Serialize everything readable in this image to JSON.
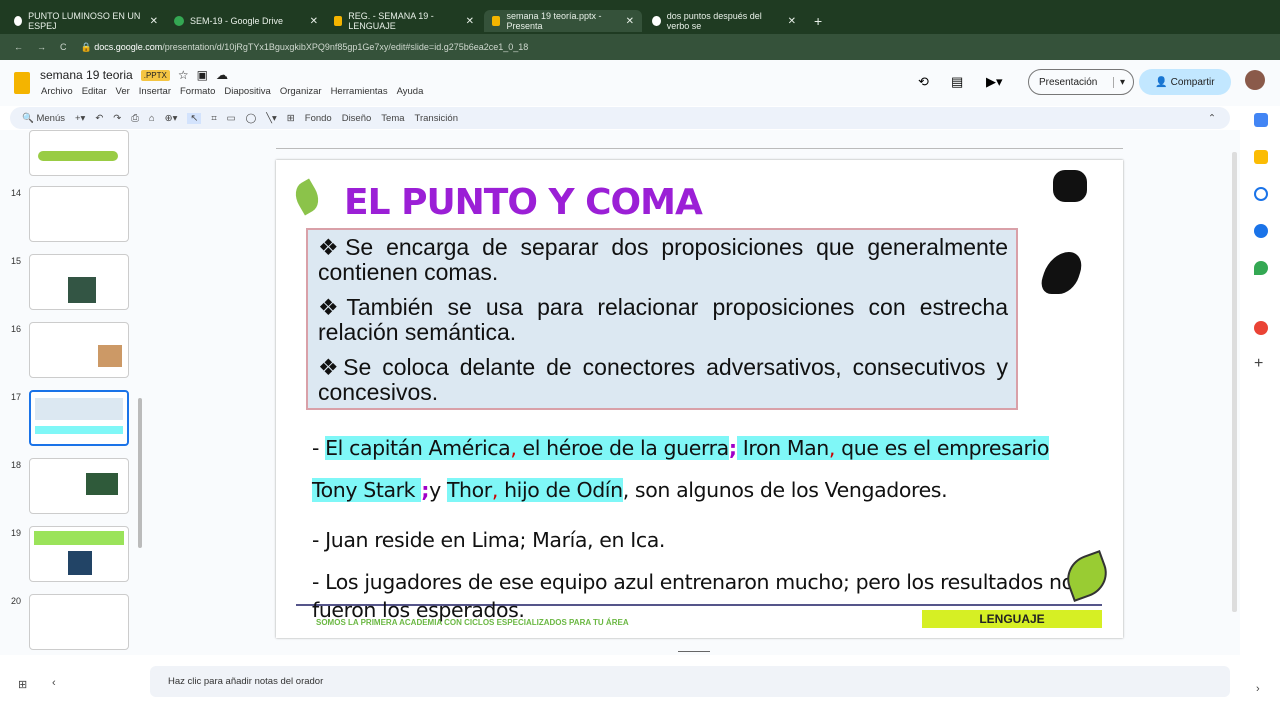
{
  "browser": {
    "tabs": [
      {
        "title": "PUNTO LUMINOSO EN UN ESPEJ",
        "active": false
      },
      {
        "title": "SEM-19 - Google Drive",
        "active": false
      },
      {
        "title": "REG. - SEMANA 19 - LENGUAJE",
        "active": false
      },
      {
        "title": "semana 19 teoría.pptx - Presenta",
        "active": true
      },
      {
        "title": "dos puntos después del verbo se",
        "active": false
      }
    ],
    "url_domain": "docs.google.com",
    "url_path": "/presentation/d/10jRgTYx1BguxgkibXPQ9nf85gp1Ge7xy/edit#slide=id.g275b6ea2ce1_0_18"
  },
  "app": {
    "doc_title": "semana 19 teoria",
    "badge": ".PPTX",
    "menu": [
      "Archivo",
      "Editar",
      "Ver",
      "Insertar",
      "Formato",
      "Diapositiva",
      "Organizar",
      "Herramientas",
      "Ayuda"
    ],
    "present_label": "Presentación",
    "share_label": "Compartir",
    "toolbar": {
      "search": "Menús",
      "fondo": "Fondo",
      "diseno": "Diseño",
      "tema": "Tema",
      "transicion": "Transición"
    }
  },
  "filmstrip": {
    "slides": [
      "14",
      "15",
      "16",
      "17",
      "18",
      "19",
      "20"
    ],
    "selected": "17"
  },
  "slide": {
    "title": "EL PUNTO Y COMA",
    "bullets": [
      "❖Se encarga de separar dos proposiciones que generalmente contienen comas.",
      "❖También se usa para relacionar proposiciones con estrecha relación semántica.",
      "❖Se coloca delante de conectores adversativos, consecutivos y concesivos."
    ],
    "ex1": {
      "a": "- ",
      "b": "El capitán América",
      "c": ",",
      "d": " el héroe de la guerra",
      "e": ";",
      "f": " Iron Man",
      "g": ",",
      "h": " que es el empresario",
      "i": "Tony Stark ",
      "j": ";",
      "k": "y ",
      "l": "Thor",
      "m": ",",
      "n": " hijo de Odín",
      "o": ", son algunos de los Vengadores."
    },
    "ex2": "- Juan reside en Lima; María, en Ica.",
    "ex3a": "- Los jugadores de ese equipo azul entrenaron mucho; pero los resultados no",
    "ex3b": "fueron los esperados.",
    "footer": "SOMOS LA PRIMERA ACADEMIA CON CICLOS ESPECIALIZADOS PARA TU ÁREA",
    "subject": "LENGUAJE"
  },
  "notes_placeholder": "Haz clic para añadir notas del orador"
}
